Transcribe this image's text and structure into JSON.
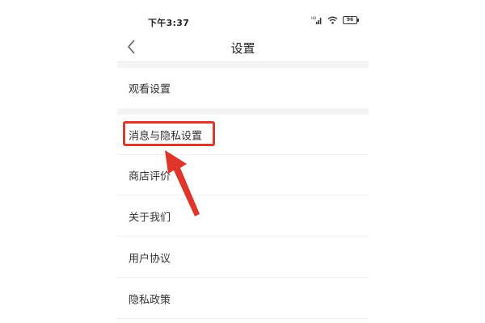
{
  "status_bar": {
    "time": "下午3:37",
    "battery": "96"
  },
  "header": {
    "title": "设置"
  },
  "settings": {
    "items": [
      {
        "label": "观看设置"
      },
      {
        "label": "消息与隐私设置"
      },
      {
        "label": "商店评价"
      },
      {
        "label": "关于我们"
      },
      {
        "label": "用户协议"
      },
      {
        "label": "隐私政策"
      }
    ]
  },
  "annotation": {
    "highlight_color": "#d83a2e",
    "highlighted_item": "消息与隐私设置"
  },
  "icons": [
    "back-arrow-icon",
    "signal-icon",
    "wifi-icon",
    "battery-icon"
  ]
}
